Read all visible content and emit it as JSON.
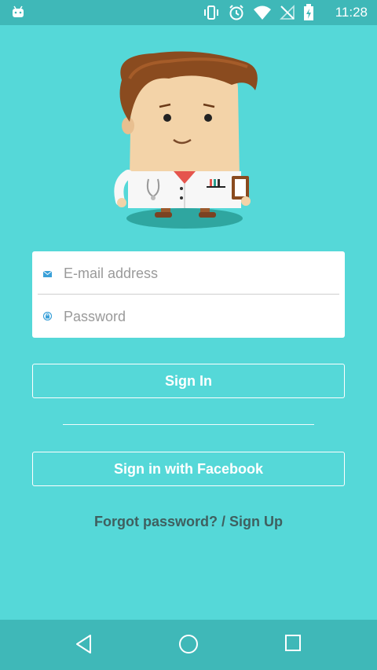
{
  "status_bar": {
    "time": "11:28",
    "icons": [
      "android-icon",
      "vibrate-icon",
      "alarm-icon",
      "wifi-icon",
      "no-signal-icon",
      "battery-charging-icon"
    ]
  },
  "login": {
    "email_placeholder": "E-mail address",
    "password_placeholder": "Password",
    "signin_label": "Sign In",
    "facebook_label": "Sign in with Facebook",
    "forgot_label": "Forgot password?",
    "separator": " / ",
    "signup_label": "Sign Up"
  },
  "nav_bar": {
    "items": [
      "back-icon",
      "home-icon",
      "recents-icon"
    ]
  },
  "colors": {
    "background": "#55d8d8",
    "status_bar": "#3fb8b8",
    "link_text": "#3f5f5f"
  }
}
